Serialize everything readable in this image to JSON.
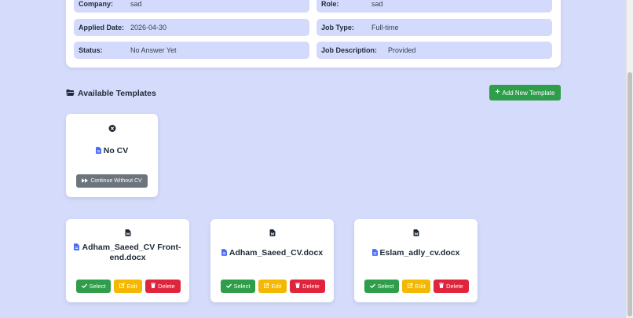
{
  "details": {
    "company_label": "Company:",
    "company_value": "sad",
    "role_label": "Role:",
    "role_value": "sad",
    "applied_label": "Applied Date:",
    "applied_value": "2026-04-30",
    "jobtype_label": "Job Type:",
    "jobtype_value": "Full-time",
    "status_label": "Status:",
    "status_value": "No Answer Yet",
    "desc_label": "Job Description:",
    "desc_value": "Provided"
  },
  "templates": {
    "section_title": "Available Templates",
    "add_button": "Add New Template",
    "no_cv": {
      "title": "No CV",
      "button": "Continue Without CV"
    },
    "items": [
      {
        "title": "Adham_Saeed_CV Front-end.docx"
      },
      {
        "title": "Adham_Saeed_CV.docx"
      },
      {
        "title": "Eslam_adly_cv.docx"
      }
    ],
    "select_label": "Select",
    "edit_label": "Edit",
    "delete_label": "Delete"
  },
  "colors": {
    "background": "#d5dcfb",
    "success": "#2f9e4a",
    "warning": "#f5b800",
    "danger": "#e0243b",
    "secondary": "#6c757d",
    "doc_icon": "#4a6cf7"
  },
  "icons": {
    "section": "folder-open-icon",
    "add": "plus-icon",
    "no_cv": "circle-x-icon",
    "continue": "fast-forward-icon",
    "file": "file-icon",
    "word_doc": "word-file-icon",
    "select": "check-icon",
    "edit": "edit-icon",
    "delete": "trash-icon"
  }
}
